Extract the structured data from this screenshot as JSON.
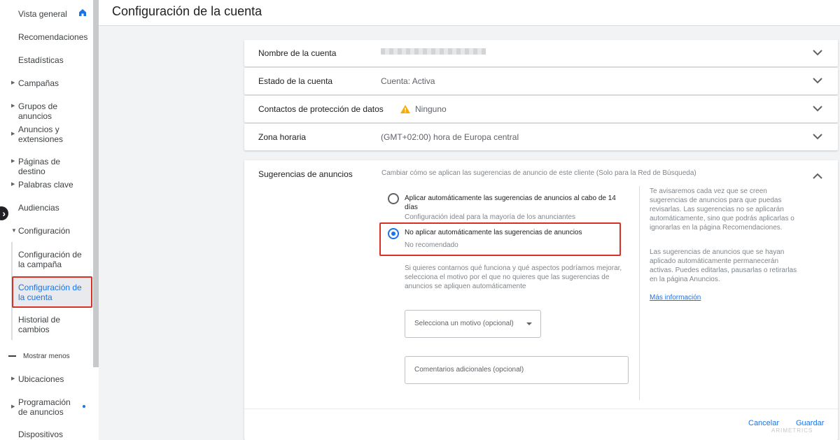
{
  "sidebar": {
    "items": [
      {
        "label": "Vista general",
        "expander": false
      },
      {
        "label": "Recomendaciones",
        "expander": false
      },
      {
        "label": "Estadísticas",
        "expander": false
      },
      {
        "label": "Campañas",
        "expander": true
      },
      {
        "label": "Grupos de anuncios",
        "expander": true
      },
      {
        "label": "Anuncios y extensiones",
        "expander": true
      },
      {
        "label": "Páginas de destino",
        "expander": true
      },
      {
        "label": "Palabras clave",
        "expander": true
      },
      {
        "label": "Audiencias",
        "expander": false
      },
      {
        "label": "Configuración",
        "expander": "open"
      }
    ],
    "sub_items": [
      {
        "label": "Configuración de la campaña"
      },
      {
        "label": "Configuración de la cuenta",
        "active": true
      },
      {
        "label": "Historial de cambios"
      }
    ],
    "show_less": "Mostrar menos",
    "more_items": [
      {
        "label": "Ubicaciones",
        "expander": true
      },
      {
        "label": "Programación de anuncios",
        "expander": true,
        "dot": true
      },
      {
        "label": "Dispositivos",
        "expander": false
      }
    ]
  },
  "header": {
    "title": "Configuración de la cuenta"
  },
  "rows": [
    {
      "label": "Nombre de la cuenta",
      "value": "",
      "redacted": true
    },
    {
      "label": "Estado de la cuenta",
      "value": "Cuenta: Activa"
    },
    {
      "label": "Contactos de protección de datos",
      "value": "Ninguno",
      "warning": true
    },
    {
      "label": "Zona horaria",
      "value": "(GMT+02:00) hora de Europa central"
    }
  ],
  "ad_suggestions": {
    "title": "Sugerencias de anuncios",
    "description": "Cambiar cómo se aplican las sugerencias de anuncio de este cliente (Solo para la Red de Búsqueda)",
    "options": [
      {
        "label": "Aplicar automáticamente las sugerencias de anuncios al cabo de 14 días",
        "sublabel": "Configuración ideal para la mayoría de los anunciantes",
        "selected": false
      },
      {
        "label": "No aplicar automáticamente las sugerencias de anuncios",
        "sublabel": "No recomendado",
        "selected": true
      }
    ],
    "feedback_hint": "Si quieres contarnos qué funciona y qué aspectos podríamos mejorar, selecciona el motivo por el que no quieres que las sugerencias de anuncios se apliquen automáticamente",
    "reason_select": "Selecciona un motivo (opcional)",
    "comments_placeholder": "Comentarios adicionales (opcional)",
    "help_text_1": "Te avisaremos cada vez que se creen sugerencias de anuncios para que puedas revisarlas. Las sugerencias no se aplicarán automáticamente, sino que podrás aplicarlas o ignorarlas en la página Recomendaciones.",
    "help_text_2": "Las sugerencias de anuncios que se hayan aplicado automáticamente permanecerán activas. Puedes editarlas, pausarlas o retirarlas en la página Anuncios.",
    "more_info": "Más información",
    "cancel": "Cancelar",
    "save": "Guardar"
  },
  "watermark": "ARIMETRICS",
  "colors": {
    "accent": "#1a73e8",
    "highlight": "#d93025",
    "warning": "#f9ab00"
  }
}
